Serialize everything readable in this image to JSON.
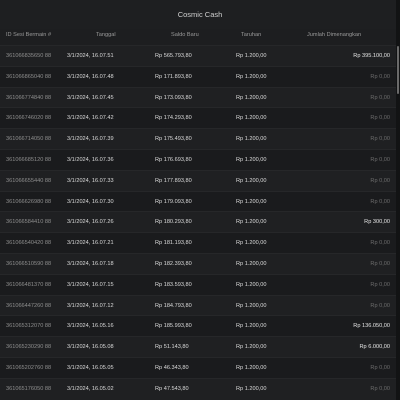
{
  "window": {
    "title": "Cosmic Cash"
  },
  "table": {
    "headers": {
      "id": "ID Sesi Bermain #",
      "date": "Tanggal",
      "balance": "Saldo Baru",
      "bet": "Taruhan",
      "win": "Jumlah Dimenangkan"
    },
    "rows": [
      {
        "id": "361066835650 88",
        "date": "3/1/2024, 16.07.51",
        "balance": "Rp 565.793,80",
        "bet": "Rp 1.200,00",
        "win": "Rp 395.100,00",
        "positive": true
      },
      {
        "id": "361066865040 88",
        "date": "3/1/2024, 16.07.48",
        "balance": "Rp 171.893,80",
        "bet": "Rp 1.200,00",
        "win": "Rp 0,00",
        "positive": false
      },
      {
        "id": "361066774840 88",
        "date": "3/1/2024, 16.07.45",
        "balance": "Rp 173.093,80",
        "bet": "Rp 1.200,00",
        "win": "Rp 0,00",
        "positive": false
      },
      {
        "id": "361066746020 88",
        "date": "3/1/2024, 16.07.42",
        "balance": "Rp 174.293,80",
        "bet": "Rp 1.200,00",
        "win": "Rp 0,00",
        "positive": false
      },
      {
        "id": "361066714050 88",
        "date": "3/1/2024, 16.07.39",
        "balance": "Rp 175.493,80",
        "bet": "Rp 1.200,00",
        "win": "Rp 0,00",
        "positive": false
      },
      {
        "id": "361066685120 88",
        "date": "3/1/2024, 16.07.36",
        "balance": "Rp 176.693,80",
        "bet": "Rp 1.200,00",
        "win": "Rp 0,00",
        "positive": false
      },
      {
        "id": "361066655440 88",
        "date": "3/1/2024, 16.07.33",
        "balance": "Rp 177.893,80",
        "bet": "Rp 1.200,00",
        "win": "Rp 0,00",
        "positive": false
      },
      {
        "id": "361066626980 88",
        "date": "3/1/2024, 16.07.30",
        "balance": "Rp 179.093,80",
        "bet": "Rp 1.200,00",
        "win": "Rp 0,00",
        "positive": false
      },
      {
        "id": "361066584410 88",
        "date": "3/1/2024, 16.07.26",
        "balance": "Rp 180.293,80",
        "bet": "Rp 1.200,00",
        "win": "Rp 300,00",
        "positive": true
      },
      {
        "id": "361066540420 88",
        "date": "3/1/2024, 16.07.21",
        "balance": "Rp 181.193,80",
        "bet": "Rp 1.200,00",
        "win": "Rp 0,00",
        "positive": false
      },
      {
        "id": "361066510590 88",
        "date": "3/1/2024, 16.07.18",
        "balance": "Rp 182.393,80",
        "bet": "Rp 1.200,00",
        "win": "Rp 0,00",
        "positive": false
      },
      {
        "id": "361066481370 88",
        "date": "3/1/2024, 16.07.15",
        "balance": "Rp 183.593,80",
        "bet": "Rp 1.200,00",
        "win": "Rp 0,00",
        "positive": false
      },
      {
        "id": "361066447260 88",
        "date": "3/1/2024, 16.07.12",
        "balance": "Rp 184.793,80",
        "bet": "Rp 1.200,00",
        "win": "Rp 0,00",
        "positive": false
      },
      {
        "id": "361065312070 88",
        "date": "3/1/2024, 16.05.16",
        "balance": "Rp 185.993,80",
        "bet": "Rp 1.200,00",
        "win": "Rp 136.050,00",
        "positive": true
      },
      {
        "id": "361065230290 88",
        "date": "3/1/2024, 16.05.08",
        "balance": "Rp 51.143,80",
        "bet": "Rp 1.200,00",
        "win": "Rp 6.000,00",
        "positive": true
      },
      {
        "id": "361065202760 88",
        "date": "3/1/2024, 16.05.05",
        "balance": "Rp 46.343,80",
        "bet": "Rp 1.200,00",
        "win": "Rp 0,00",
        "positive": false
      },
      {
        "id": "361065176050 88",
        "date": "3/1/2024, 16.05.02",
        "balance": "Rp 47.543,80",
        "bet": "Rp 1.200,00",
        "win": "Rp 0,00",
        "positive": false
      }
    ]
  },
  "colors": {
    "background": "#1b1c1e",
    "win_positive": "#e4e4e4",
    "win_zero": "#6c6c6c"
  }
}
